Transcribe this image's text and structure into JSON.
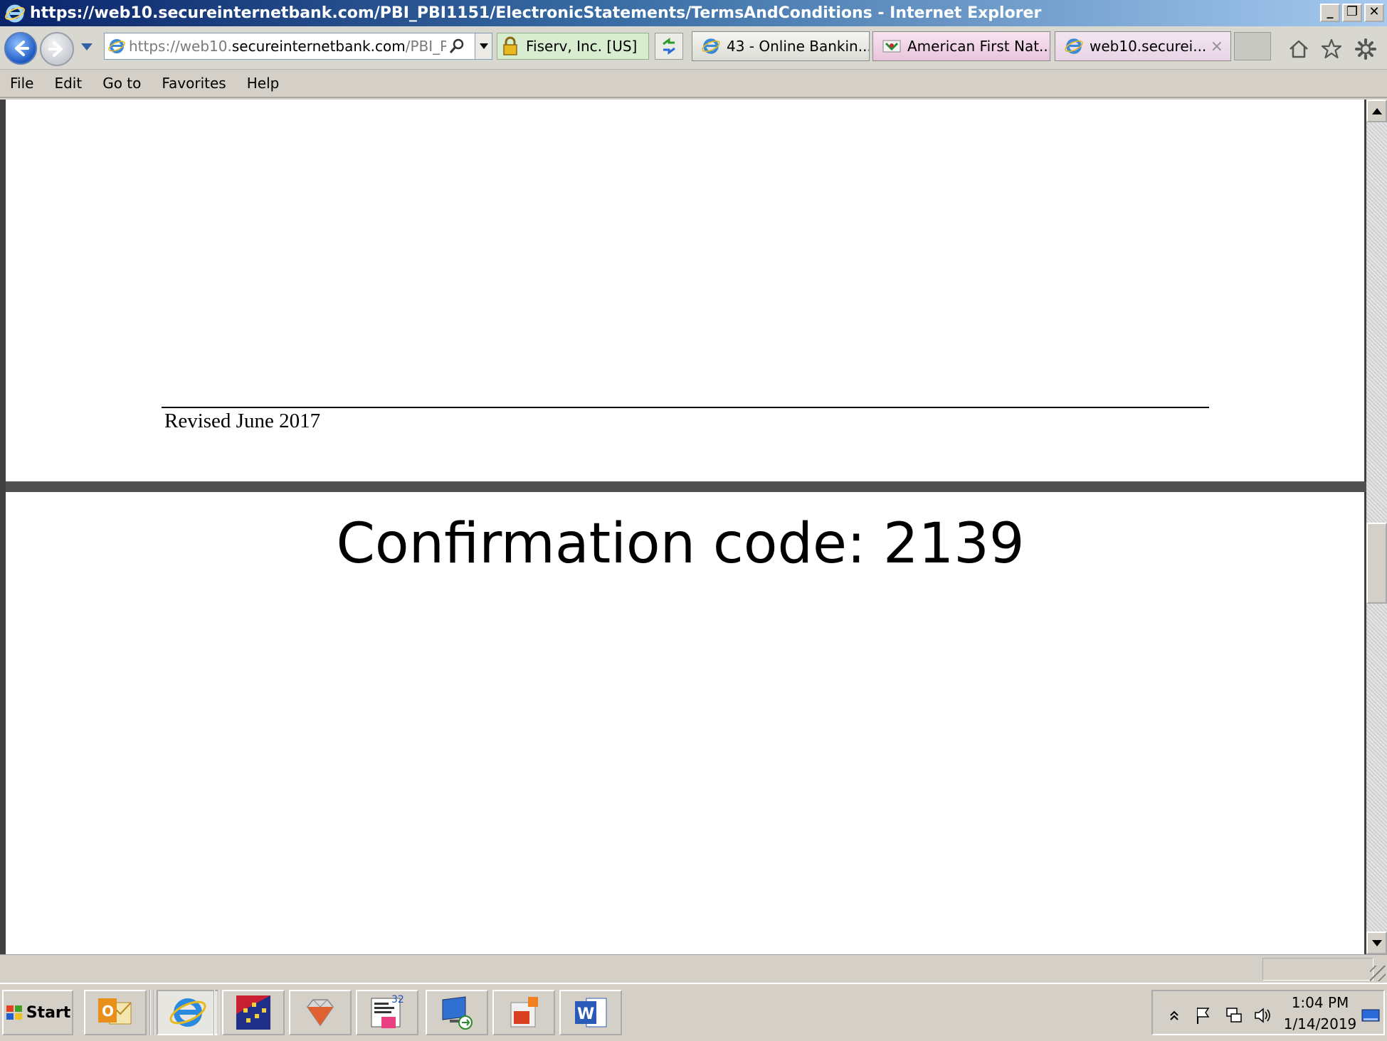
{
  "window": {
    "title": "https://web10.secureinternetbank.com/PBI_PBI1151/ElectronicStatements/TermsAndConditions - Internet Explorer",
    "minimize": "_",
    "restore": "❐",
    "close": "✕"
  },
  "address_bar": {
    "url_dim_prefix": "https://",
    "url_dim_host": "web10.",
    "url_strong": "secureinternetbank.com",
    "url_dim_suffix": "/PBI_PBI",
    "security_label": "Fiserv, Inc. [US]"
  },
  "tabs": [
    {
      "label": "43 - Online Bankin..."
    },
    {
      "label": "American First Nat..."
    },
    {
      "label": "web10.securei...",
      "close": "×"
    }
  ],
  "menu": [
    "File",
    "Edit",
    "Go to",
    "Favorites",
    "Help"
  ],
  "page": {
    "revised": "Revised June 2017",
    "confirmation": "Confirmation code: 2139"
  },
  "scrollbar": {
    "position": 0.55,
    "visible_fraction": 0.1
  },
  "taskbar": {
    "start_label": "Start",
    "clock_time": "1:04 PM",
    "clock_date": "1/14/2019"
  },
  "icons": {
    "tray": [
      "show-hidden-icon",
      "flag-icon",
      "network-icon",
      "volume-icon",
      "desktop-icon"
    ]
  },
  "colors": {
    "title_gradient_start": "#0a246a",
    "title_gradient_end": "#a6caf0",
    "security_bg": "#d8ecd0"
  }
}
